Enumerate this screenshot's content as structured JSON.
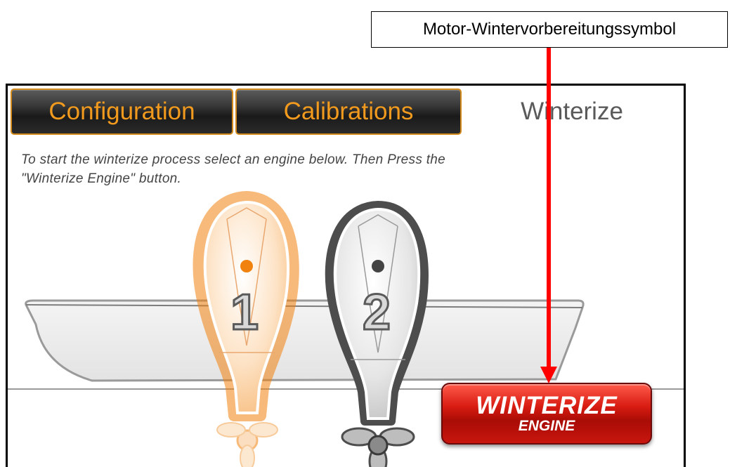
{
  "callout": {
    "text": "Motor-Wintervorbereitungssymbol"
  },
  "tabs": {
    "configuration": "Configuration",
    "calibrations": "Calibrations",
    "winterize": "Winterize"
  },
  "instructions": {
    "line1": "To start the winterize process select an engine below. Then Press the",
    "line2": "\"Winterize Engine\" button."
  },
  "engines": [
    {
      "number": "1",
      "selected": true,
      "color": "#f2820f"
    },
    {
      "number": "2",
      "selected": false,
      "color": "#7a7a7a"
    }
  ],
  "winterize_button": {
    "line1": "WINTERIZE",
    "line2": "ENGINE",
    "color": "#d81c12"
  },
  "colors": {
    "tab_text": "#f19a1e",
    "arrow": "#ff0000"
  }
}
